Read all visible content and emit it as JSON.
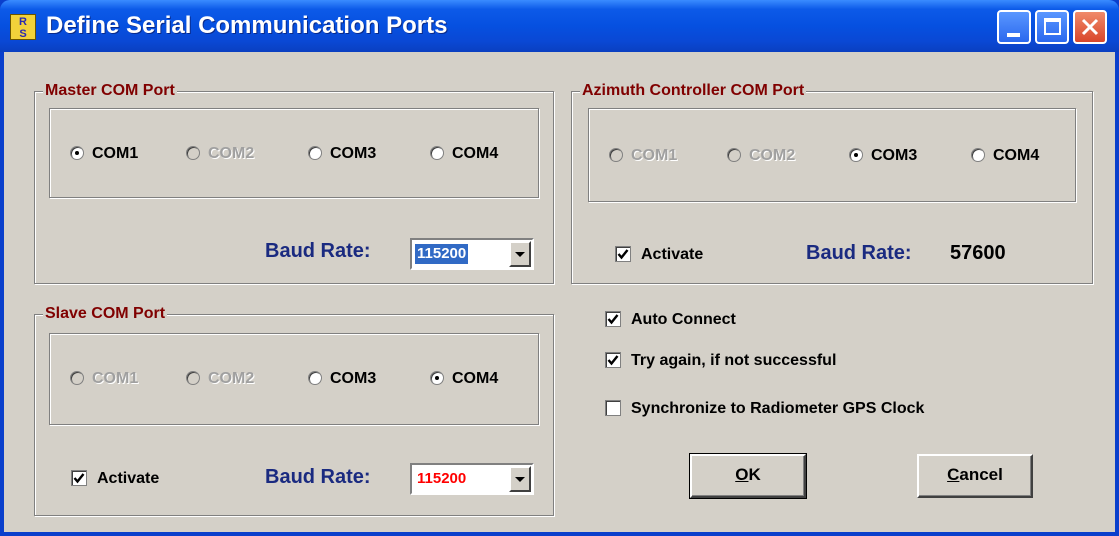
{
  "window": {
    "title": "Define Serial Communication Ports",
    "icon": "app-logo-icon"
  },
  "master": {
    "title": "Master COM Port",
    "ports": [
      {
        "label": "COM1",
        "selected": true,
        "enabled": true
      },
      {
        "label": "COM2",
        "selected": false,
        "enabled": false
      },
      {
        "label": "COM3",
        "selected": false,
        "enabled": true
      },
      {
        "label": "COM4",
        "selected": false,
        "enabled": true
      }
    ],
    "baud_label": "Baud Rate:",
    "baud_value": "115200"
  },
  "azimuth": {
    "title": "Azimuth Controller COM Port",
    "ports": [
      {
        "label": "COM1",
        "selected": false,
        "enabled": false
      },
      {
        "label": "COM2",
        "selected": false,
        "enabled": false
      },
      {
        "label": "COM3",
        "selected": true,
        "enabled": true
      },
      {
        "label": "COM4",
        "selected": false,
        "enabled": true
      }
    ],
    "activate_label": "Activate",
    "activate_checked": true,
    "baud_label": "Baud Rate:",
    "baud_value": "57600"
  },
  "slave": {
    "title": "Slave COM Port",
    "ports": [
      {
        "label": "COM1",
        "selected": false,
        "enabled": false
      },
      {
        "label": "COM2",
        "selected": false,
        "enabled": false
      },
      {
        "label": "COM3",
        "selected": false,
        "enabled": true
      },
      {
        "label": "COM4",
        "selected": true,
        "enabled": true
      }
    ],
    "activate_label": "Activate",
    "activate_checked": true,
    "baud_label": "Baud Rate:",
    "baud_value": "115200"
  },
  "options": {
    "auto_connect": {
      "label": "Auto Connect",
      "checked": true
    },
    "try_again": {
      "label": "Try again, if not successful",
      "checked": true
    },
    "sync_gps": {
      "label": "Synchronize to Radiometer GPS Clock",
      "checked": false
    }
  },
  "buttons": {
    "ok": "OK",
    "cancel": "Cancel"
  },
  "colors": {
    "title_bar": "#0650e0",
    "dialog_bg": "#d4d0c8",
    "group_title": "#800000",
    "baud_label": "#1a2a80",
    "combo_highlight": "#316ac5",
    "slave_baud_text": "#ff0000",
    "disabled_text": "#a0a0a0"
  }
}
